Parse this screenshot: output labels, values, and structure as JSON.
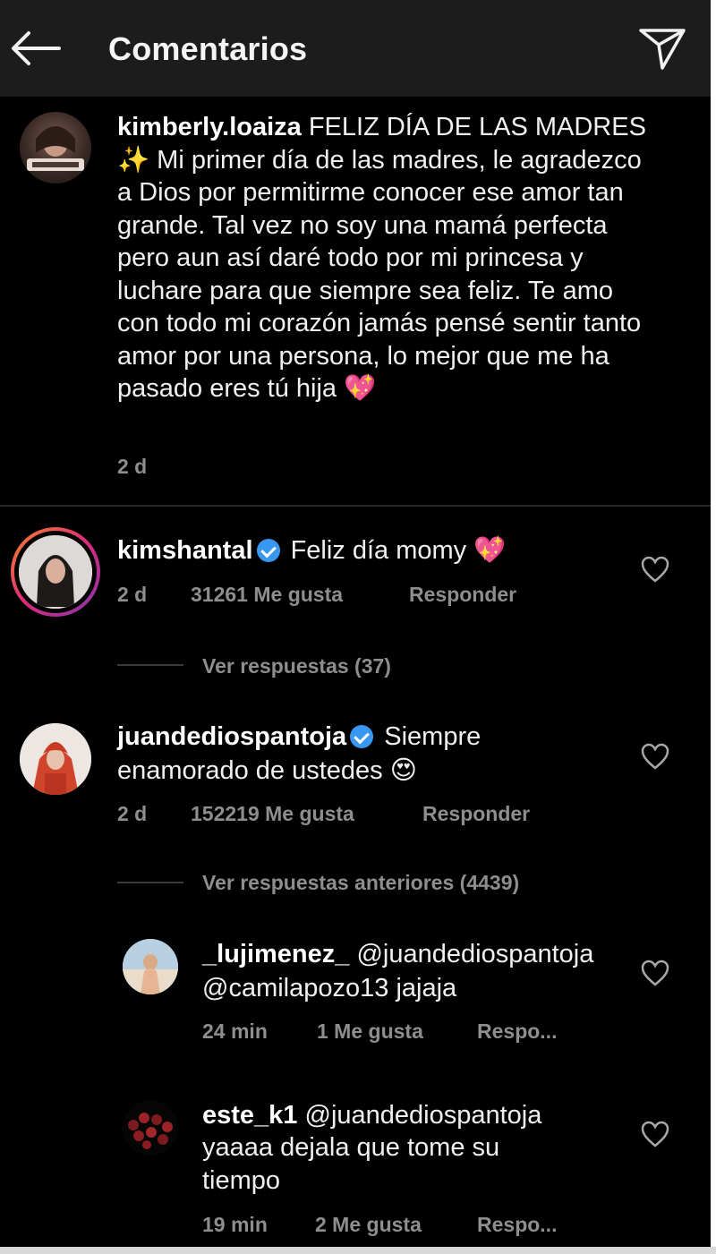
{
  "header": {
    "title": "Comentarios",
    "back_icon": "arrow-left-icon",
    "share_icon": "paper-plane-icon"
  },
  "caption": {
    "username": "kimberly.loaiza",
    "text": " FELIZ DÍA DE LAS MADRES ✨ Mi primer día de las madres, le agradezco a Dios por permitirme conocer ese amor tan grande. Tal vez no soy una mamá perfecta pero aun así daré todo por mi princesa y luchare para que siempre sea feliz. Te amo con todo mi corazón jamás pensé sentir tanto amor por una persona, lo mejor que me ha pasado eres tú hija 💖",
    "time": "2 d"
  },
  "comments": [
    {
      "username": "kimshantal",
      "text": "Feliz día momy 💖",
      "time": "2 d",
      "likes": "31261 Me gusta",
      "reply": "Responder",
      "view_replies": "Ver respuestas (37)"
    },
    {
      "username": "juandediospantoja",
      "text": "Siempre",
      "text_line2": "enamorado de ustedes 😍",
      "time": "2 d",
      "likes": "152219 Me gusta",
      "reply": "Responder",
      "view_replies": "Ver respuestas anteriores (4439)"
    }
  ],
  "replies": [
    {
      "username": "_lujimenez_",
      "text": "@juandediospantoja",
      "text_line2": "@camilapozo13 jajaja",
      "time": "24 min",
      "likes": "1 Me gusta",
      "reply": "Respo..."
    },
    {
      "username": "este_k1",
      "text": "@juandediospantoja",
      "text_line2": "yaaaa dejala que tome su",
      "text_line3": "tiempo",
      "time": "19 min",
      "likes": "2 Me gusta",
      "reply": "Respo..."
    }
  ],
  "colors": {
    "background": "#000000",
    "header": "#1c1c1c",
    "muted": "#8e8e8e",
    "verified": "#3897f0",
    "story_ring": "#e1306c"
  }
}
